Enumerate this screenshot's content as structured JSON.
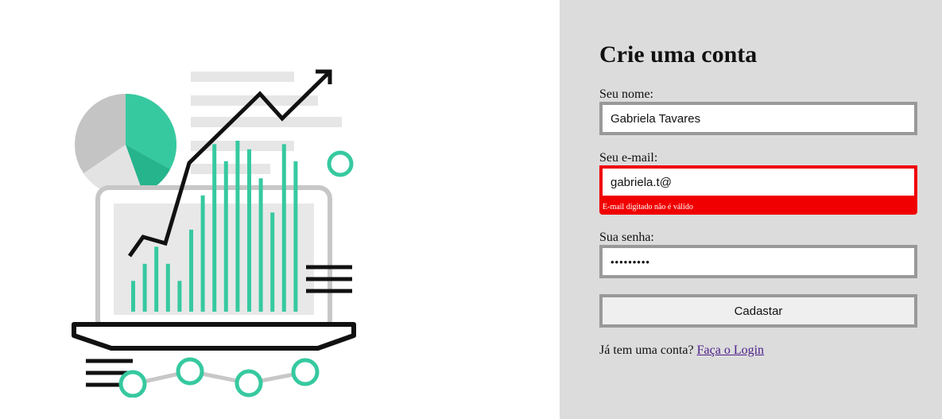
{
  "form": {
    "title": "Crie uma conta",
    "name_label": "Seu nome:",
    "name_value": "Gabriela Tavares",
    "email_label": "Seu e-mail:",
    "email_value": "gabriela.t@",
    "email_error": "E-mail digitado não é válido",
    "password_label": "Sua senha:",
    "password_value": "•••••••••",
    "submit_label": "Cadastar",
    "login_prompt": "Já tem uma conta?",
    "login_link": "Faça o Login"
  },
  "colors": {
    "accent_green": "#36c9a0",
    "error_red": "#f00000",
    "panel_bg": "#dcdcdc",
    "link": "#4b1e8a"
  },
  "illustration": {
    "chart_bars": [
      0.18,
      0.28,
      0.38,
      0.28,
      0.18,
      0.48,
      0.68,
      0.98,
      0.88,
      1.0,
      0.95,
      0.78,
      0.58,
      0.98,
      0.88
    ],
    "pie_share_green": 0.35
  }
}
